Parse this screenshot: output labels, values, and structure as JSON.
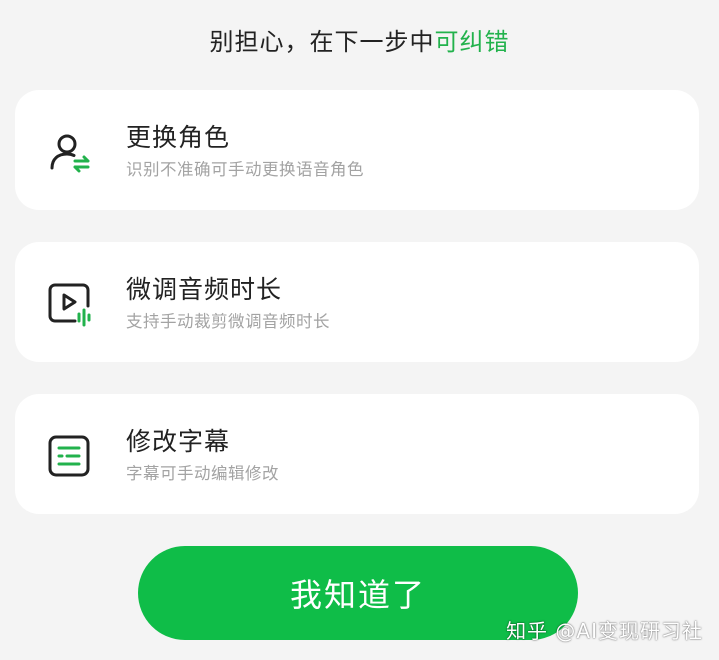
{
  "header": {
    "text_prefix": "别担心，在下一步中",
    "text_accent": "可纠错"
  },
  "cards": [
    {
      "icon": "change-role-icon",
      "title": "更换角色",
      "description": "识别不准确可手动更换语音角色"
    },
    {
      "icon": "audio-duration-icon",
      "title": "微调音频时长",
      "description": "支持手动裁剪微调音频时长"
    },
    {
      "icon": "subtitle-icon",
      "title": "修改字幕",
      "description": "字幕可手动编辑修改"
    }
  ],
  "confirm_button": {
    "label": "我知道了"
  },
  "watermark": {
    "text": "知乎 @AI变现研习社"
  },
  "colors": {
    "accent": "#22b24c",
    "button": "#0fbd48",
    "background": "#f4f4f4",
    "card": "#ffffff"
  }
}
